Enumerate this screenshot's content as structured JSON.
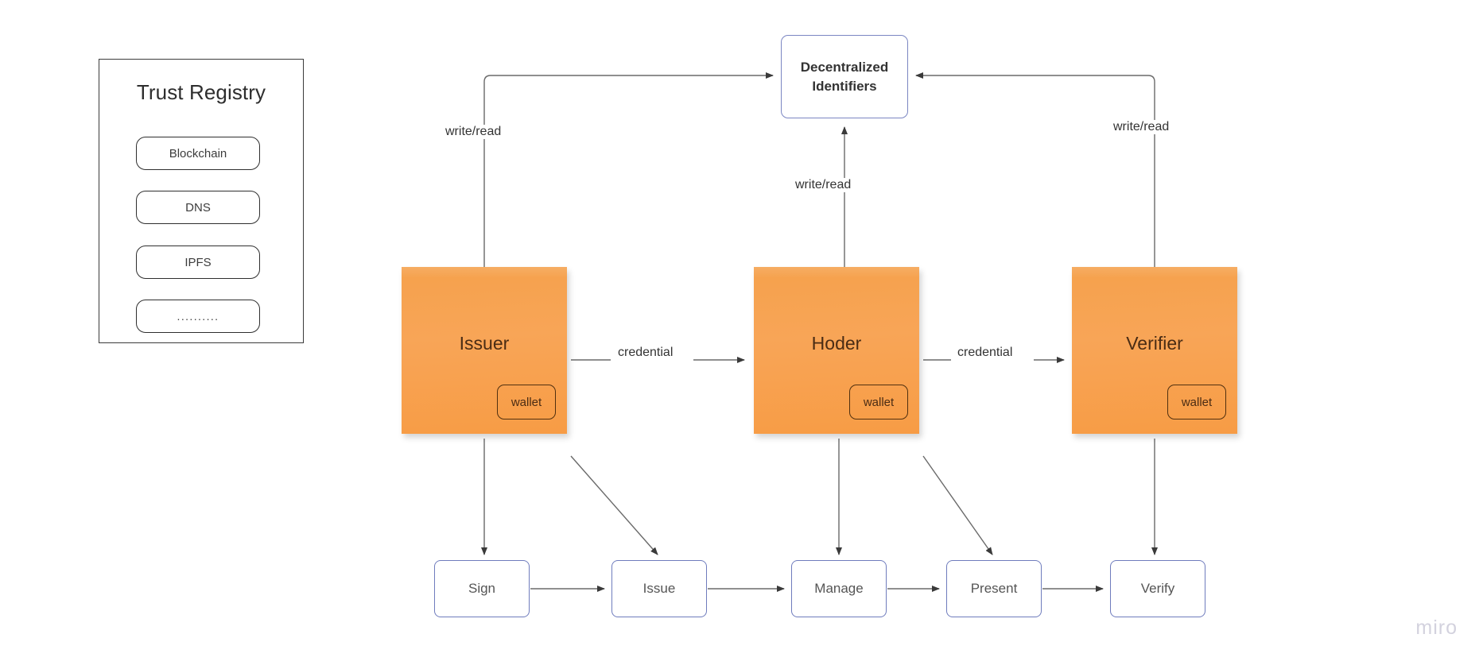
{
  "registry": {
    "title": "Trust Registry",
    "items": [
      {
        "label": "Blockchain"
      },
      {
        "label": "DNS"
      },
      {
        "label": "IPFS"
      },
      {
        "label": ".........."
      }
    ]
  },
  "did": {
    "line1": "Decentralized",
    "line2": "Identifiers",
    "border_color": "#7b86c2"
  },
  "actors": [
    {
      "name": "Issuer",
      "wallet_label": "wallet"
    },
    {
      "name": "Hoder",
      "wallet_label": "wallet"
    },
    {
      "name": "Verifier",
      "wallet_label": "wallet"
    }
  ],
  "sticky_color": "#f5a14c",
  "process_steps": [
    {
      "label": "Sign"
    },
    {
      "label": "Issue"
    },
    {
      "label": "Manage"
    },
    {
      "label": "Present"
    },
    {
      "label": "Verify"
    }
  ],
  "edge_labels": {
    "write_read_left": "write/read",
    "write_read_middle": "write/read",
    "write_read_right": "write/read",
    "credential_1": "credential",
    "credential_2": "credential"
  },
  "watermark": "miro"
}
